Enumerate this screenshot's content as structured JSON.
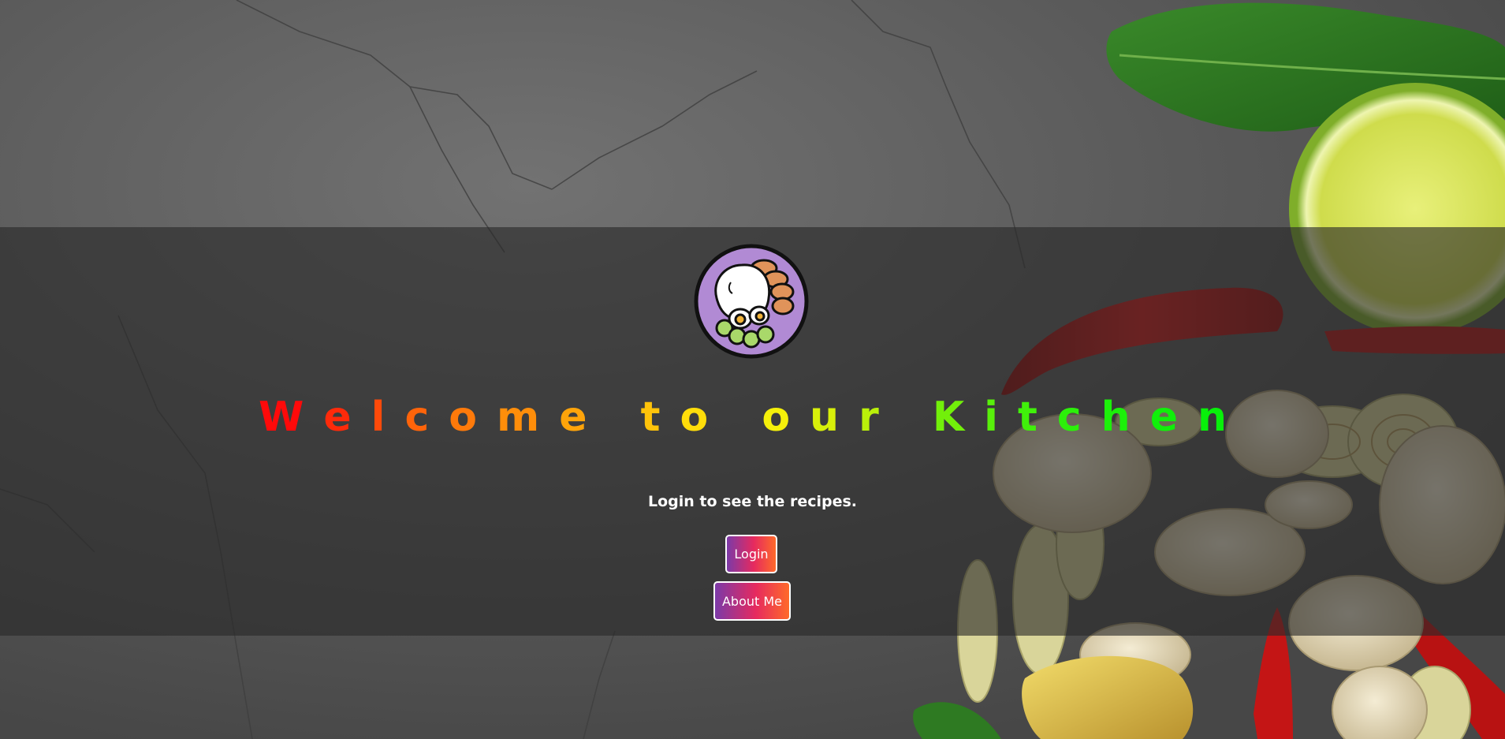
{
  "hero": {
    "title_letters": [
      {
        "ch": "W",
        "color": "#ff0a0a"
      },
      {
        "ch": "e",
        "color": "#ff2a0a"
      },
      {
        "ch": "l",
        "color": "#ff4a0a"
      },
      {
        "ch": "c",
        "color": "#ff640a"
      },
      {
        "ch": "o",
        "color": "#ff7a0a"
      },
      {
        "ch": "m",
        "color": "#ff8e0a"
      },
      {
        "ch": "e",
        "color": "#ffa40a"
      },
      {
        "ch": " ",
        "color": "#ffffff"
      },
      {
        "ch": "t",
        "color": "#ffc30a"
      },
      {
        "ch": "o",
        "color": "#ffdd0a"
      },
      {
        "ch": " ",
        "color": "#ffffff"
      },
      {
        "ch": "o",
        "color": "#f5f00a"
      },
      {
        "ch": "u",
        "color": "#d8f00a"
      },
      {
        "ch": "r",
        "color": "#baf00a"
      },
      {
        "ch": " ",
        "color": "#ffffff"
      },
      {
        "ch": "K",
        "color": "#72f00a"
      },
      {
        "ch": "i",
        "color": "#58f00a"
      },
      {
        "ch": "t",
        "color": "#40f00a"
      },
      {
        "ch": "c",
        "color": "#2cf00a"
      },
      {
        "ch": "h",
        "color": "#1cf00a"
      },
      {
        "ch": "e",
        "color": "#10f00a"
      },
      {
        "ch": "n",
        "color": "#08f00a"
      }
    ],
    "subtitle": "Login to see the recipes.",
    "login_label": "Login",
    "about_label": "About Me",
    "button_gradient": [
      "#7b3aa8",
      "#e62a5f",
      "#ff6a2a"
    ],
    "logo_icon": "rice-bowl-icon"
  }
}
